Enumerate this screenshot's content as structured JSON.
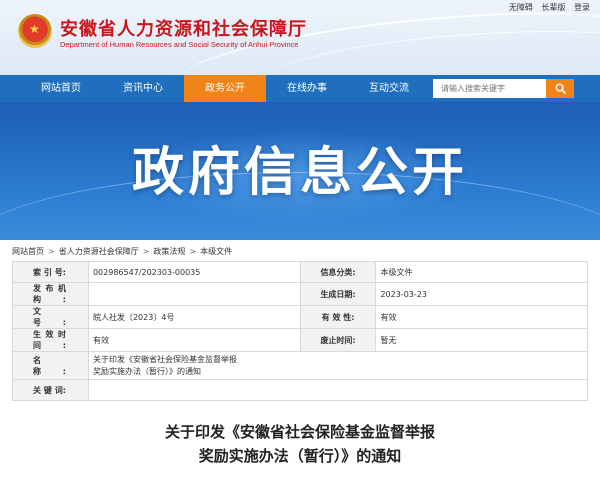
{
  "header": {
    "title": "安徽省人力资源和社会保障厅",
    "subtitle": "Department of Human Resources and Social Security of Anhui Province",
    "top_links": [
      "无障碍",
      "长辈版",
      "登录"
    ]
  },
  "nav": {
    "items": [
      {
        "label": "网站首页",
        "active": false
      },
      {
        "label": "资讯中心",
        "active": false
      },
      {
        "label": "政务公开",
        "active": true
      },
      {
        "label": "在线办事",
        "active": false
      },
      {
        "label": "互动交流",
        "active": false
      }
    ],
    "search_placeholder": "请输入搜索关键字",
    "active_color": "#f08418",
    "nav_color": "#1f6fbe"
  },
  "banner": {
    "title": "政府信息公开"
  },
  "breadcrumb": [
    "网站首页",
    "省人力资源社会保障厅",
    "政策法规",
    "本级文件"
  ],
  "info": {
    "rows": [
      {
        "l1": "索 引 号:",
        "v1": "002986547/202303-00035",
        "l2": "信息分类:",
        "v2": "本级文件"
      },
      {
        "l1": "发布机构:",
        "v1": "",
        "l2": "生成日期:",
        "v2": "2023-03-23"
      },
      {
        "l1": "文　　号:",
        "v1": "皖人社发〔2023〕4号",
        "l2": "有 效 性:",
        "v2": "有效"
      },
      {
        "l1": "生效时间:",
        "v1": "有效",
        "l2": "废止时间:",
        "v2": "暂无"
      }
    ],
    "name_label": "名　　称:",
    "name_value_line1": "关于印发《安徽省社会保险基金监督举报",
    "name_value_line2": "奖励实施办法（暂行）》的通知",
    "keywords_label": "关 键 词:",
    "keywords_value": ""
  },
  "article": {
    "title_line1": "关于印发《安徽省社会保险基金监督举报",
    "title_line2": "奖励实施办法（暂行）》的通知"
  }
}
